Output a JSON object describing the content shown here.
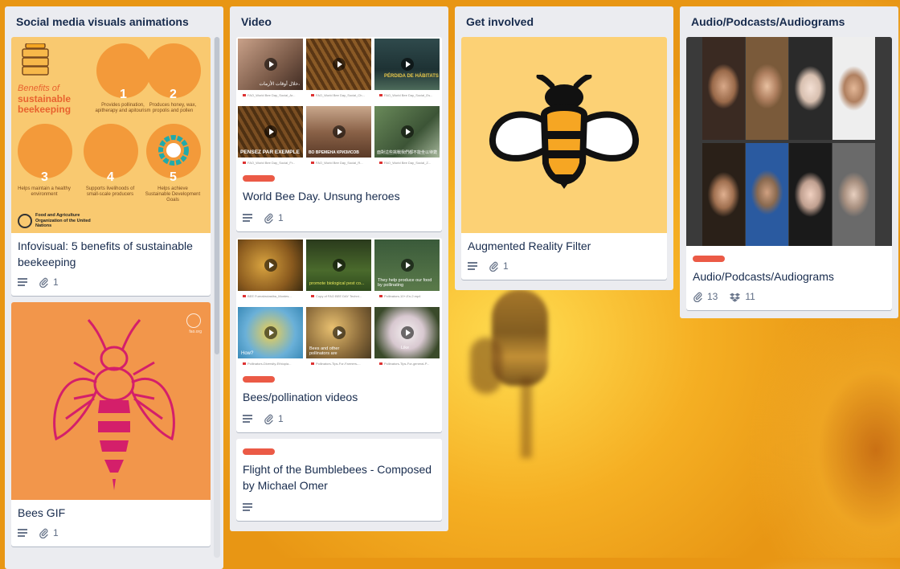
{
  "lists": [
    {
      "title": "Social media visuals animations",
      "cards": [
        {
          "title": "Infovisual: 5 benefits of sustainable beekeeping",
          "attachments": "1",
          "cover_text": {
            "heading_small": "Benefits of",
            "heading_bold": "sustainable beekeeping",
            "items": [
              {
                "num": "1",
                "text": "Provides pollination, apitherapy and apitourism"
              },
              {
                "num": "2",
                "text": "Produces honey, wax, propolis and pollen"
              },
              {
                "num": "3",
                "text": "Helps maintain a healthy environment"
              },
              {
                "num": "4",
                "text": "Supports livelihoods of small-scale producers"
              },
              {
                "num": "5",
                "text": "Helps achieve Sustainable Development Goals"
              }
            ],
            "org": "Food and Agriculture Organization of the United Nations"
          }
        },
        {
          "title": "Bees GIF",
          "attachments": "1",
          "cover_logo": "fao.org"
        }
      ]
    },
    {
      "title": "Video",
      "cards": [
        {
          "title": "World Bee Day. Unsung heroes",
          "attachments": "1",
          "thumbs": [
            {
              "overlay": "خلال أوقات الأزمات،",
              "caption": "FAO_World Bee Day_Social_Ar..."
            },
            {
              "overlay": "",
              "caption": "FAO_World Bee Day_Social_Ch..."
            },
            {
              "overlay": "PÉRDIDA DE HÁBITATS",
              "caption": "FAO_World Bee Day_Social_Es..."
            },
            {
              "overlay": "PENSEZ PAR EXEMPLE",
              "caption": "FAO_World Bee Day_Social_Fr..."
            },
            {
              "overlay": "ВО ВРЕМЕНА КРИЗИСОВ",
              "caption": "FAO_World Bee Day_Social_R..."
            },
            {
              "overlay": "面對這些挑戰我們都不能坐以待斃",
              "caption": "FAO_World Bee Day_Social_Z..."
            }
          ]
        },
        {
          "title": "Bees/pollination videos",
          "attachments": "1",
          "thumbs": [
            {
              "overlay": "",
              "caption": "BEE Fuerabrutaslba_Montes..."
            },
            {
              "overlay": "promote biological pest co...",
              "caption": "Copy of FAO BEE DAY Techni..."
            },
            {
              "overlay": "They help produce our food by pollinating",
              "caption": "Pollinators-10+-En-2.mp4"
            },
            {
              "overlay": "How?",
              "caption": "Pollinators-Diversity-Ethiopia..."
            },
            {
              "overlay": "Bees and other pollinators are",
              "caption": "Pollinators-Tips-For-Farmers-..."
            },
            {
              "overlay": "Like",
              "caption": "Pollinators-Tips-For-general-P..."
            }
          ]
        },
        {
          "title": "Flight of the Bumblebees - Composed by Michael Omer"
        }
      ]
    },
    {
      "title": "Get involved",
      "cards": [
        {
          "title": "Augmented Reality Filter",
          "attachments": "1"
        }
      ]
    },
    {
      "title": "Audio/Podcasts/Audiograms",
      "cards": [
        {
          "title": "Audio/Podcasts/Audiograms",
          "attachments": "13",
          "dropbox": "11"
        }
      ]
    }
  ],
  "colors": {
    "label_red": "#eb5a46",
    "list_bg": "#ebecf0",
    "text": "#172b4d",
    "badge": "#5e6c84"
  }
}
